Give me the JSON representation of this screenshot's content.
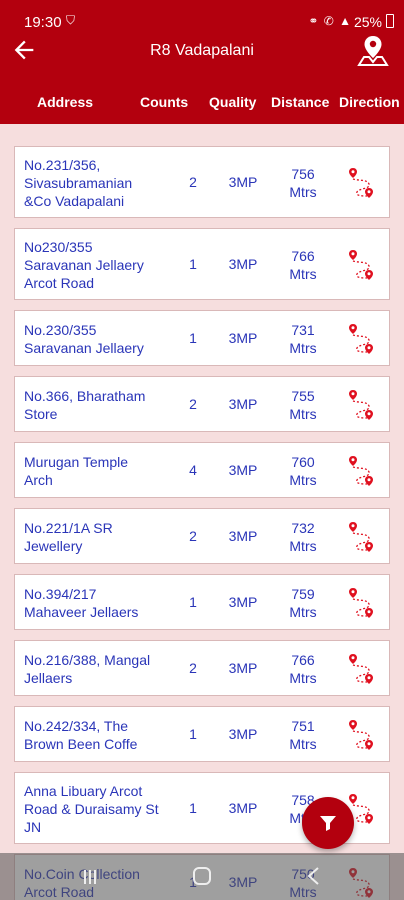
{
  "status": {
    "time": "19:30",
    "battery": "25%"
  },
  "header": {
    "title": "R8 Vadapalani"
  },
  "columns": {
    "address": "Address",
    "counts": "Counts",
    "quality": "Quality",
    "distance": "Distance",
    "direction": "Direction"
  },
  "rows": [
    {
      "address": [
        "No.231/356,",
        "Sivasubramanian",
        "&Co Vadapalani"
      ],
      "count": "2",
      "quality": "3MP",
      "distance": [
        "756",
        "Mtrs"
      ]
    },
    {
      "address": [
        "No230/355",
        "Saravanan Jellaery",
        "Arcot Road"
      ],
      "count": "1",
      "quality": "3MP",
      "distance": [
        "766",
        "Mtrs"
      ]
    },
    {
      "address": [
        "No.230/355",
        "Saravanan Jellaery"
      ],
      "count": "1",
      "quality": "3MP",
      "distance": [
        "731",
        "Mtrs"
      ]
    },
    {
      "address": [
        "No.366, Bharatham",
        "Store"
      ],
      "count": "2",
      "quality": "3MP",
      "distance": [
        "755",
        "Mtrs"
      ]
    },
    {
      "address": [
        "Murugan Temple",
        "Arch"
      ],
      "count": "4",
      "quality": "3MP",
      "distance": [
        "760",
        "Mtrs"
      ]
    },
    {
      "address": [
        "No.221/1A SR",
        "Jewellery"
      ],
      "count": "2",
      "quality": "3MP",
      "distance": [
        "732",
        "Mtrs"
      ]
    },
    {
      "address": [
        "No.394/217",
        "Mahaveer Jellaers"
      ],
      "count": "1",
      "quality": "3MP",
      "distance": [
        "759",
        "Mtrs"
      ]
    },
    {
      "address": [
        "No.216/388, Mangal",
        "Jellaers"
      ],
      "count": "2",
      "quality": "3MP",
      "distance": [
        "766",
        "Mtrs"
      ]
    },
    {
      "address": [
        "No.242/334, The",
        "Brown Been Coffe"
      ],
      "count": "1",
      "quality": "3MP",
      "distance": [
        "751",
        "Mtrs"
      ]
    },
    {
      "address": [
        "Anna Libuary Arcot",
        "Road & Duraisamy St",
        "JN"
      ],
      "count": "1",
      "quality": "3MP",
      "distance": [
        "758",
        "Mtrs"
      ]
    },
    {
      "address": [
        "No.Coin Collection",
        "Arcot Road"
      ],
      "count": "1",
      "quality": "3MP",
      "distance": [
        "750",
        "Mtrs"
      ]
    }
  ],
  "colors": {
    "primary": "#b3000e",
    "text_blue": "#2a35b8",
    "background": "#f6dede"
  }
}
